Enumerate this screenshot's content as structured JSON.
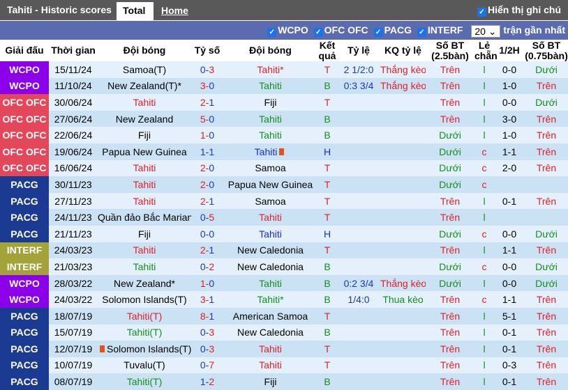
{
  "header": {
    "title": "Tahiti - Historic scores",
    "tabs": [
      {
        "label": "Total"
      },
      {
        "label": "Home"
      }
    ],
    "show_notes": "Hiển thị ghi chú"
  },
  "filters": {
    "items": [
      "WCPO",
      "OFC OFC",
      "PACG",
      "INTERF"
    ],
    "count": "20",
    "count_suffix": "trận gần nhất"
  },
  "columns": [
    "Giải đấu",
    "Thời gian",
    "Đội bóng",
    "Tỷ số",
    "Đội bóng",
    "Kết quả",
    "Tỷ lệ",
    "KQ tỷ lệ",
    "Số BT (2.5bàn)",
    "Lẻ chẵn",
    "1/2H",
    "Số BT (0.75bàn)"
  ],
  "league_colors": {
    "WCPO": "#8b00e8",
    "OFC OFC": "#e2475a",
    "PACG": "#1b3a91",
    "INTERF": "#a3a33a"
  },
  "rows": [
    {
      "league": "WCPO",
      "date": "15/11/24",
      "home": "Samoa(T)",
      "hg": "0",
      "ag": "3",
      "away": "Tahiti*",
      "res": "T",
      "odds": "2 1/2:0",
      "kq": "Thắng kèo",
      "bt": "Trên",
      "lc": "l",
      "h1": "0-0",
      "bt2": "Dưới"
    },
    {
      "league": "WCPO",
      "date": "11/10/24",
      "home": "New Zealand(T)*",
      "hg": "3",
      "ag": "0",
      "away": "Tahiti",
      "res": "B",
      "odds": "0:3 3/4",
      "kq": "Thắng kèo",
      "bt": "Trên",
      "lc": "l",
      "h1": "1-0",
      "bt2": "Trên"
    },
    {
      "league": "OFC OFC",
      "date": "30/06/24",
      "home": "Tahiti",
      "hg": "2",
      "ag": "1",
      "away": "Fiji",
      "res": "T",
      "odds": "",
      "kq": "",
      "bt": "Trên",
      "lc": "l",
      "h1": "0-0",
      "bt2": "Dưới"
    },
    {
      "league": "OFC OFC",
      "date": "27/06/24",
      "home": "New Zealand",
      "hg": "5",
      "ag": "0",
      "away": "Tahiti",
      "res": "B",
      "odds": "",
      "kq": "",
      "bt": "Trên",
      "lc": "l",
      "h1": "3-0",
      "bt2": "Trên"
    },
    {
      "league": "OFC OFC",
      "date": "22/06/24",
      "home": "Fiji",
      "hg": "1",
      "ag": "0",
      "away": "Tahiti",
      "res": "B",
      "odds": "",
      "kq": "",
      "bt": "Dưới",
      "lc": "l",
      "h1": "1-0",
      "bt2": "Trên"
    },
    {
      "league": "OFC OFC",
      "date": "19/06/24",
      "home": "Papua New Guinea",
      "hg": "1",
      "ag": "1",
      "away": "Tahiti",
      "res": "H",
      "odds": "",
      "kq": "",
      "bt": "Dưới",
      "lc": "c",
      "h1": "1-1",
      "bt2": "Trên",
      "away_card": true
    },
    {
      "league": "OFC OFC",
      "date": "16/06/24",
      "home": "Tahiti",
      "hg": "2",
      "ag": "0",
      "away": "Samoa",
      "res": "T",
      "odds": "",
      "kq": "",
      "bt": "Dưới",
      "lc": "c",
      "h1": "2-0",
      "bt2": "Trên"
    },
    {
      "league": "PACG",
      "date": "30/11/23",
      "home": "Tahiti",
      "hg": "2",
      "ag": "0",
      "away": "Papua New Guinea",
      "res": "T",
      "odds": "",
      "kq": "",
      "bt": "Dưới",
      "lc": "c",
      "h1": "",
      "bt2": ""
    },
    {
      "league": "PACG",
      "date": "27/11/23",
      "home": "Tahiti",
      "hg": "2",
      "ag": "1",
      "away": "Samoa",
      "res": "T",
      "odds": "",
      "kq": "",
      "bt": "Trên",
      "lc": "l",
      "h1": "0-1",
      "bt2": "Trên"
    },
    {
      "league": "PACG",
      "date": "24/11/23",
      "home": "Quần đảo Bắc Mariana",
      "hg": "0",
      "ag": "5",
      "away": "Tahiti",
      "res": "T",
      "odds": "",
      "kq": "",
      "bt": "Trên",
      "lc": "l",
      "h1": "",
      "bt2": ""
    },
    {
      "league": "PACG",
      "date": "21/11/23",
      "home": "Fiji",
      "hg": "0",
      "ag": "0",
      "away": "Tahiti",
      "res": "H",
      "odds": "",
      "kq": "",
      "bt": "Dưới",
      "lc": "c",
      "h1": "0-0",
      "bt2": "Dưới"
    },
    {
      "league": "INTERF",
      "date": "24/03/23",
      "home": "Tahiti",
      "hg": "2",
      "ag": "1",
      "away": "New Caledonia",
      "res": "T",
      "odds": "",
      "kq": "",
      "bt": "Trên",
      "lc": "l",
      "h1": "1-1",
      "bt2": "Trên"
    },
    {
      "league": "INTERF",
      "date": "21/03/23",
      "home": "Tahiti",
      "hg": "0",
      "ag": "2",
      "away": "New Caledonia",
      "res": "B",
      "odds": "",
      "kq": "",
      "bt": "Dưới",
      "lc": "c",
      "h1": "0-0",
      "bt2": "Dưới"
    },
    {
      "league": "WCPO",
      "date": "28/03/22",
      "home": "New Zealand*",
      "hg": "1",
      "ag": "0",
      "away": "Tahiti",
      "res": "B",
      "odds": "0:2 3/4",
      "kq": "Thắng kèo",
      "bt": "Dưới",
      "lc": "l",
      "h1": "0-0",
      "bt2": "Dưới"
    },
    {
      "league": "WCPO",
      "date": "24/03/22",
      "home": "Solomon Islands(T)",
      "hg": "3",
      "ag": "1",
      "away": "Tahiti*",
      "res": "B",
      "odds": "1/4:0",
      "kq": "Thua kèo",
      "bt": "Trên",
      "lc": "c",
      "h1": "1-1",
      "bt2": "Trên"
    },
    {
      "league": "PACG",
      "date": "18/07/19",
      "home": "Tahiti(T)",
      "hg": "8",
      "ag": "1",
      "away": "American Samoa",
      "res": "T",
      "odds": "",
      "kq": "",
      "bt": "Trên",
      "lc": "l",
      "h1": "5-1",
      "bt2": "Trên"
    },
    {
      "league": "PACG",
      "date": "15/07/19",
      "home": "Tahiti(T)",
      "hg": "0",
      "ag": "3",
      "away": "New Caledonia",
      "res": "B",
      "odds": "",
      "kq": "",
      "bt": "Trên",
      "lc": "l",
      "h1": "0-1",
      "bt2": "Trên"
    },
    {
      "league": "PACG",
      "date": "12/07/19",
      "home": "Solomon Islands(T)",
      "hg": "0",
      "ag": "3",
      "away": "Tahiti",
      "res": "T",
      "odds": "",
      "kq": "",
      "bt": "Trên",
      "lc": "l",
      "h1": "0-1",
      "bt2": "Trên",
      "home_card": true
    },
    {
      "league": "PACG",
      "date": "10/07/19",
      "home": "Tuvalu(T)",
      "hg": "0",
      "ag": "7",
      "away": "Tahiti",
      "res": "T",
      "odds": "",
      "kq": "",
      "bt": "Trên",
      "lc": "l",
      "h1": "0-3",
      "bt2": "Trên"
    },
    {
      "league": "PACG",
      "date": "08/07/19",
      "home": "Tahiti(T)",
      "hg": "1",
      "ag": "2",
      "away": "Fiji",
      "res": "B",
      "odds": "",
      "kq": "",
      "bt": "Trên",
      "lc": "l",
      "h1": "0-1",
      "bt2": "Trên"
    }
  ]
}
